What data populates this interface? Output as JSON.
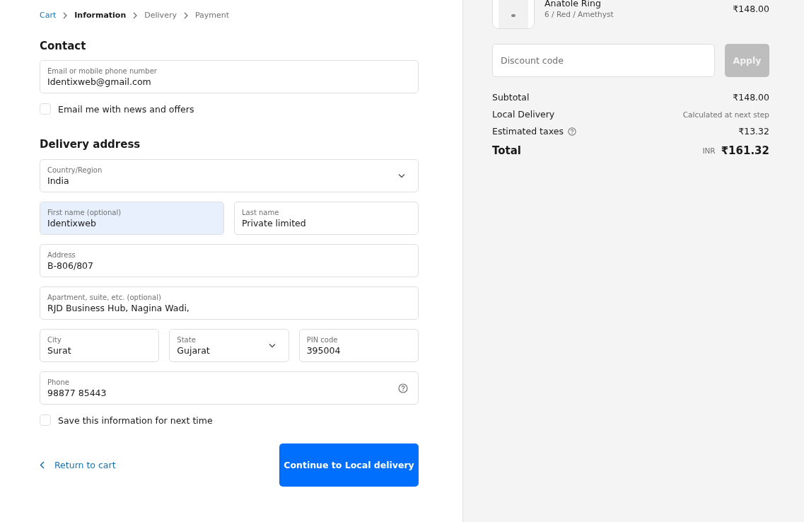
{
  "breadcrumb": [
    {
      "label": "Cart",
      "selected": false,
      "visited": true
    },
    {
      "label": "Information",
      "selected": true,
      "visited": false
    },
    {
      "label": "Delivery",
      "selected": false,
      "visited": false
    },
    {
      "label": "Payment",
      "selected": false,
      "visited": false
    }
  ],
  "contact": {
    "heading": "Contact",
    "field": {
      "label": "Email or mobile phone number",
      "value": "Identixweb@gmail.com"
    },
    "newsletter": {
      "label": "Email me with news and offers",
      "checked": false
    }
  },
  "delivery": {
    "heading": "Delivery address",
    "rows": [
      [
        {
          "kind": "select",
          "label": "Country/Region",
          "value": "India",
          "autofilled": false
        }
      ],
      [
        {
          "kind": "text",
          "label": "First name (optional)",
          "value": "Identixweb",
          "autofilled": true
        },
        {
          "kind": "text",
          "label": "Last name",
          "value": "Private limited",
          "autofilled": false
        }
      ],
      [
        {
          "kind": "text",
          "label": "Address",
          "value": "B-806/807",
          "autofilled": false
        }
      ],
      [
        {
          "kind": "text",
          "label": "Apartment, suite, etc. (optional)",
          "value": "RJD Business Hub, Nagina Wadi,",
          "autofilled": false
        }
      ],
      [
        {
          "kind": "text",
          "label": "City",
          "value": "Surat",
          "autofilled": false
        },
        {
          "kind": "select",
          "label": "State",
          "value": "Gujarat",
          "autofilled": false
        },
        {
          "kind": "text",
          "label": "PIN code",
          "value": "395004",
          "autofilled": false
        }
      ],
      [
        {
          "kind": "help",
          "label": "Phone",
          "value": "98877 85443",
          "autofilled": false
        }
      ]
    ],
    "save": {
      "label": "Save this information for next time",
      "checked": false
    }
  },
  "actions": {
    "back": "Return to cart",
    "continue": "Continue to Local delivery"
  },
  "summary": {
    "product": {
      "name": "Anatole Ring",
      "variant": "6 / Red / Amethyst",
      "price": "₹148.00"
    },
    "discount": {
      "placeholder": "Discount code",
      "button": "Apply",
      "disabled": true
    },
    "lines": [
      {
        "label": "Subtotal",
        "value": "₹148.00",
        "kind": "amount"
      },
      {
        "label": "Local Delivery",
        "value": "Calculated at next step",
        "kind": "note"
      },
      {
        "label": "Estimated taxes",
        "value": "₹13.32",
        "kind": "explained"
      }
    ],
    "total": {
      "label": "Total",
      "currency": "INR",
      "value": "₹161.32"
    }
  }
}
